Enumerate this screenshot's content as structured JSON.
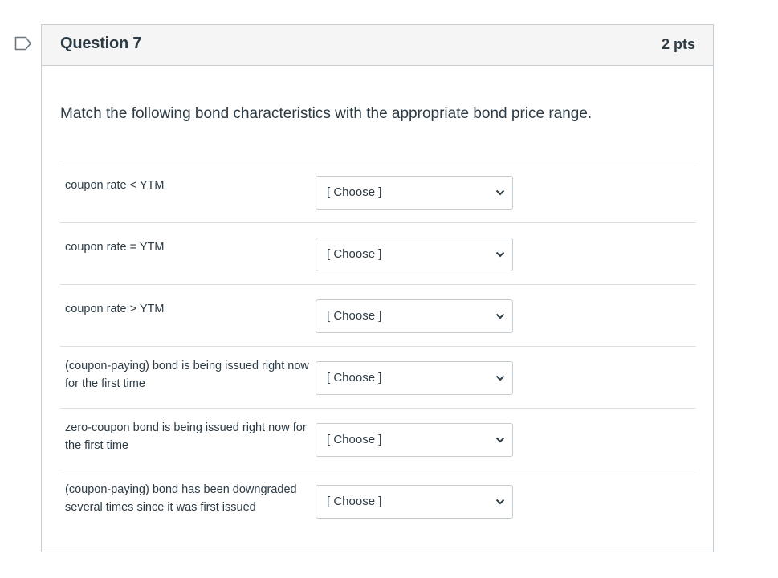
{
  "question": {
    "title": "Question 7",
    "points": "2 pts",
    "prompt": "Match the following bond characteristics with the appropriate bond price range.",
    "flag_icon": "bookmark-flag-icon"
  },
  "matches": [
    {
      "label": "coupon rate < YTM",
      "selected": "[ Choose ]"
    },
    {
      "label": "coupon rate = YTM",
      "selected": "[ Choose ]"
    },
    {
      "label": "coupon rate > YTM",
      "selected": "[ Choose ]"
    },
    {
      "label": "(coupon-paying) bond is being issued right now for the first time",
      "selected": "[ Choose ]"
    },
    {
      "label": "zero-coupon bond is being issued right now for the first time",
      "selected": "[ Choose ]"
    },
    {
      "label": "(coupon-paying) bond has been downgraded several times since it was first issued",
      "selected": "[ Choose ]"
    }
  ],
  "colors": {
    "text": "#2d3b45",
    "header_bg": "#f5f5f5",
    "border": "#c7cdd1"
  }
}
